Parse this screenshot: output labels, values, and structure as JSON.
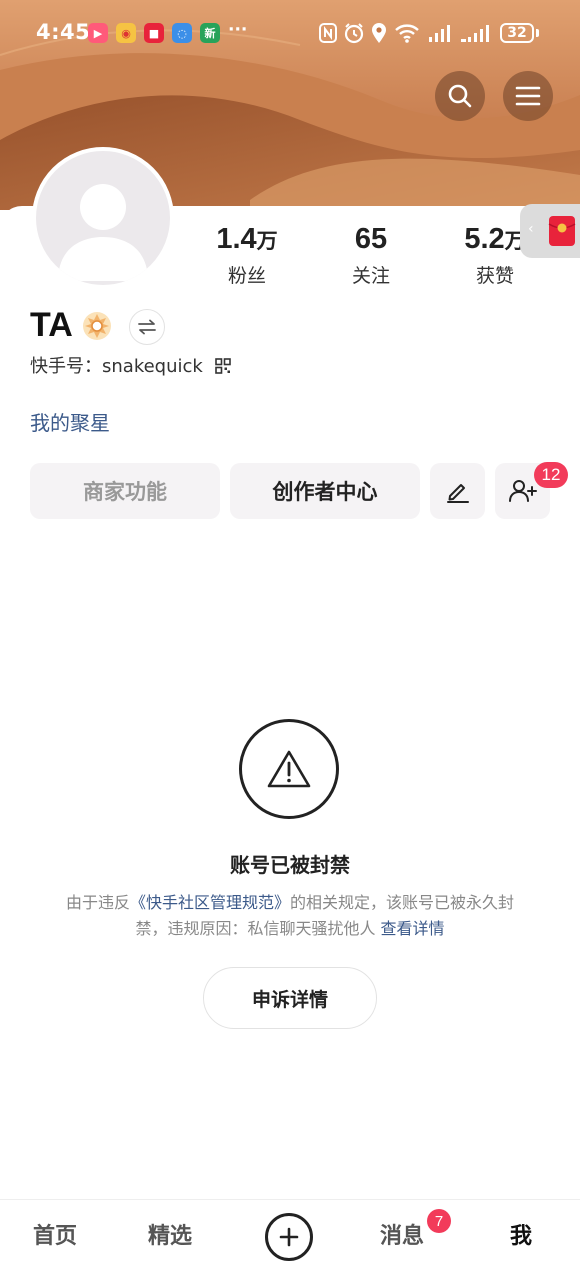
{
  "status_bar": {
    "time": "4:45",
    "more": "···",
    "battery": "32",
    "notif_icons": [
      "kuaishou-icon",
      "weibo-icon",
      "red-app-icon",
      "chat-icon",
      "news-icon"
    ],
    "news_icon_text": "新"
  },
  "header": {
    "search_icon": "search-icon",
    "menu_icon": "menu-icon"
  },
  "profile": {
    "name": "TA",
    "id_label": "快手号：snakequick",
    "star_link": "我的聚星",
    "stats": [
      {
        "value": "1.4",
        "unit": "万",
        "label": "粉丝"
      },
      {
        "value": "65",
        "unit": "",
        "label": "关注"
      },
      {
        "value": "5.2",
        "unit": "万",
        "label": "获赞"
      }
    ]
  },
  "actions": {
    "merchant": "商家功能",
    "creator": "创作者中心",
    "friend_badge": "12"
  },
  "banned": {
    "title": "账号已被封禁",
    "desc_part1": "由于违反",
    "desc_link": "《快手社区管理规范》",
    "desc_part2": "的相关规定，该账号已被永久封禁，违规原因：私信聊天骚扰他人",
    "details_link": "查看详情",
    "appeal_button": "申诉详情"
  },
  "bottom_nav": {
    "home": "首页",
    "featured": "精选",
    "messages": "消息",
    "messages_badge": "7",
    "me": "我"
  },
  "colors": {
    "header": "#c37545",
    "link": "#3c5a8a",
    "badge": "#f23b5a"
  }
}
